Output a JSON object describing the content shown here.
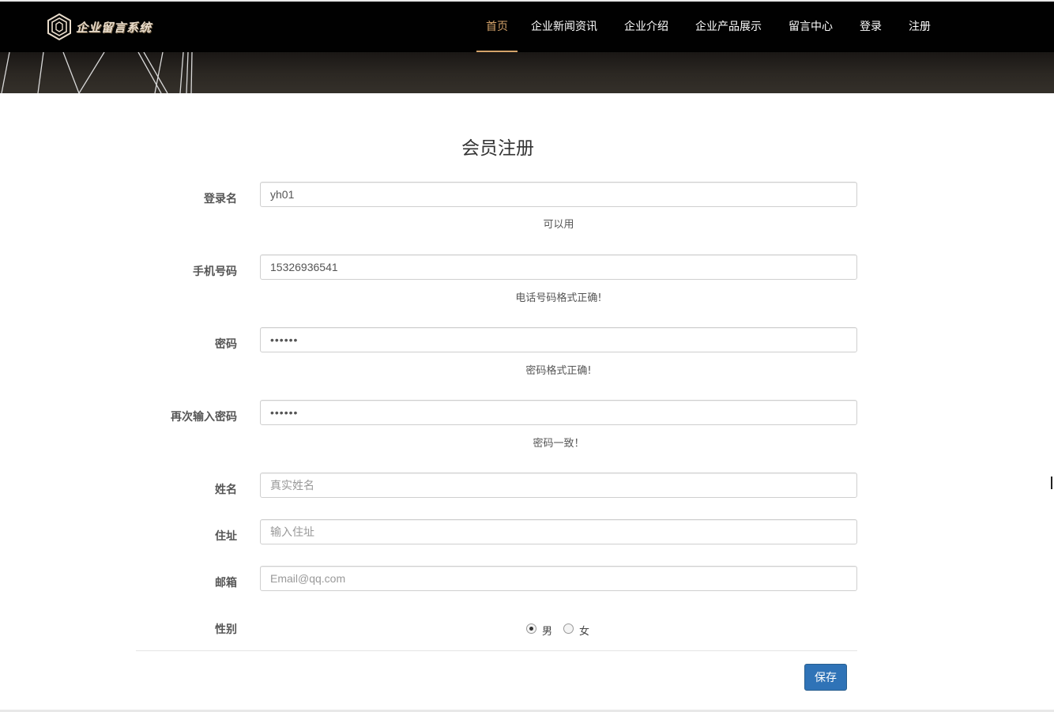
{
  "header": {
    "logo_text": "企业留言系统",
    "nav_items": [
      "首页",
      "企业新闻资讯",
      "企业介绍",
      "企业产品展示",
      "留言中心",
      "登录",
      "注册"
    ],
    "active_index": 0,
    "accent_color": "#d4a36a"
  },
  "form": {
    "title": "会员注册",
    "username": {
      "label": "登录名",
      "value": "yh01",
      "hint": "可以用"
    },
    "phone": {
      "label": "手机号码",
      "value": "15326936541",
      "hint": "电话号码格式正确!"
    },
    "password": {
      "label": "密码",
      "value": "••••••",
      "hint": "密码格式正确!"
    },
    "confirm_password": {
      "label": "再次输入密码",
      "value": "••••••",
      "hint": "密码一致！"
    },
    "realname": {
      "label": "姓名",
      "placeholder": "真实姓名"
    },
    "address": {
      "label": "住址",
      "placeholder": "输入住址"
    },
    "email": {
      "label": "邮箱",
      "placeholder": "Email@qq.com"
    },
    "gender": {
      "label": "性别",
      "options": [
        "男",
        "女"
      ],
      "selected": "男"
    },
    "save_label": "保存",
    "save_color": "#2f73b7"
  }
}
